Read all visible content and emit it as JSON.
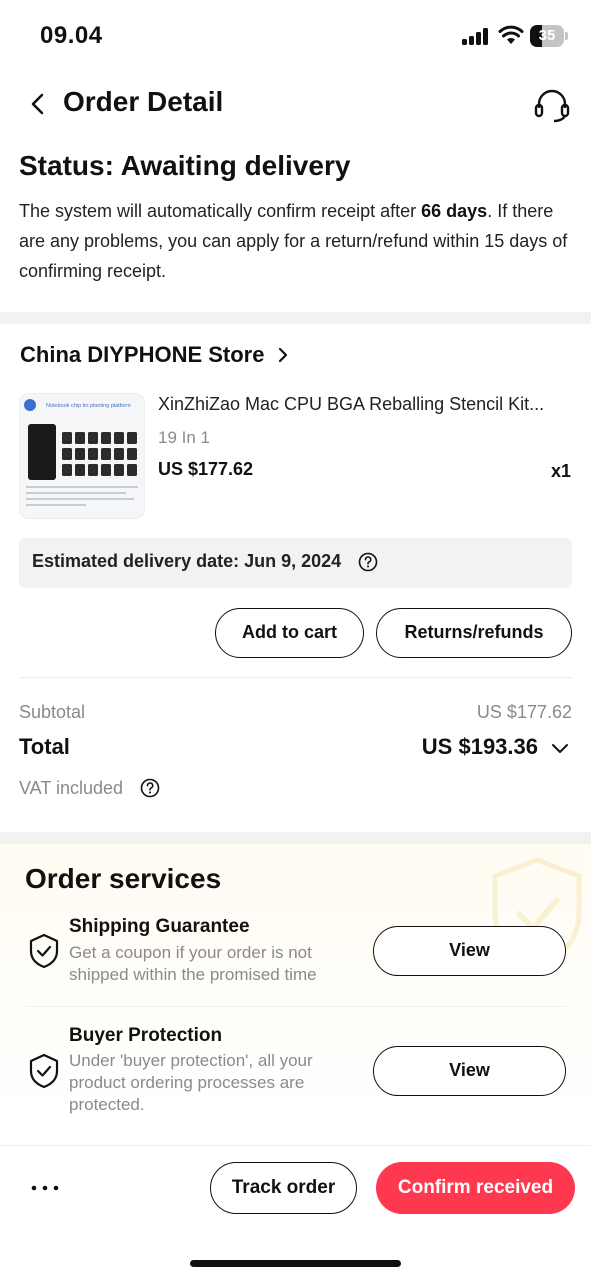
{
  "status_bar": {
    "time": "09.04",
    "battery": "35",
    "battery_level": 0.35
  },
  "nav": {
    "title": "Order Detail"
  },
  "status": {
    "title": "Status: Awaiting delivery",
    "desc_prefix": "The system will automatically confirm receipt after ",
    "desc_bold": "66 days",
    "desc_suffix": ". If there are any problems, you can apply for a return/refund within 15 days of confirming receipt."
  },
  "store": {
    "name": "China DIYPHONE Store"
  },
  "product": {
    "title": "XinZhiZao Mac CPU BGA Reballing Stencil Kit...",
    "variant": "19 In 1",
    "price": "US $177.62",
    "qty": "x1",
    "thumb_caption": "Notebook chip tin planting platform"
  },
  "delivery": {
    "label": "Estimated delivery date: Jun 9, 2024"
  },
  "actions": {
    "add_to_cart": "Add to cart",
    "returns": "Returns/refunds"
  },
  "summary": {
    "subtotal_label": "Subtotal",
    "subtotal_value": "US $177.62",
    "total_label": "Total",
    "total_value": "US $193.36",
    "vat_label": "VAT included"
  },
  "services": {
    "title": "Order services",
    "items": [
      {
        "title": "Shipping Guarantee",
        "desc": "Get a coupon if your order is not shipped within the promised time",
        "button": "View"
      },
      {
        "title": "Buyer Protection",
        "desc": "Under 'buyer protection', all your product ordering processes are protected.",
        "button": "View"
      }
    ]
  },
  "bottom": {
    "more": "more-dots-icon",
    "track": "Track order",
    "confirm": "Confirm received"
  },
  "colors": {
    "accent": "#fd384f",
    "panel": "#f2f2f2",
    "muted": "#8a8a8a"
  }
}
